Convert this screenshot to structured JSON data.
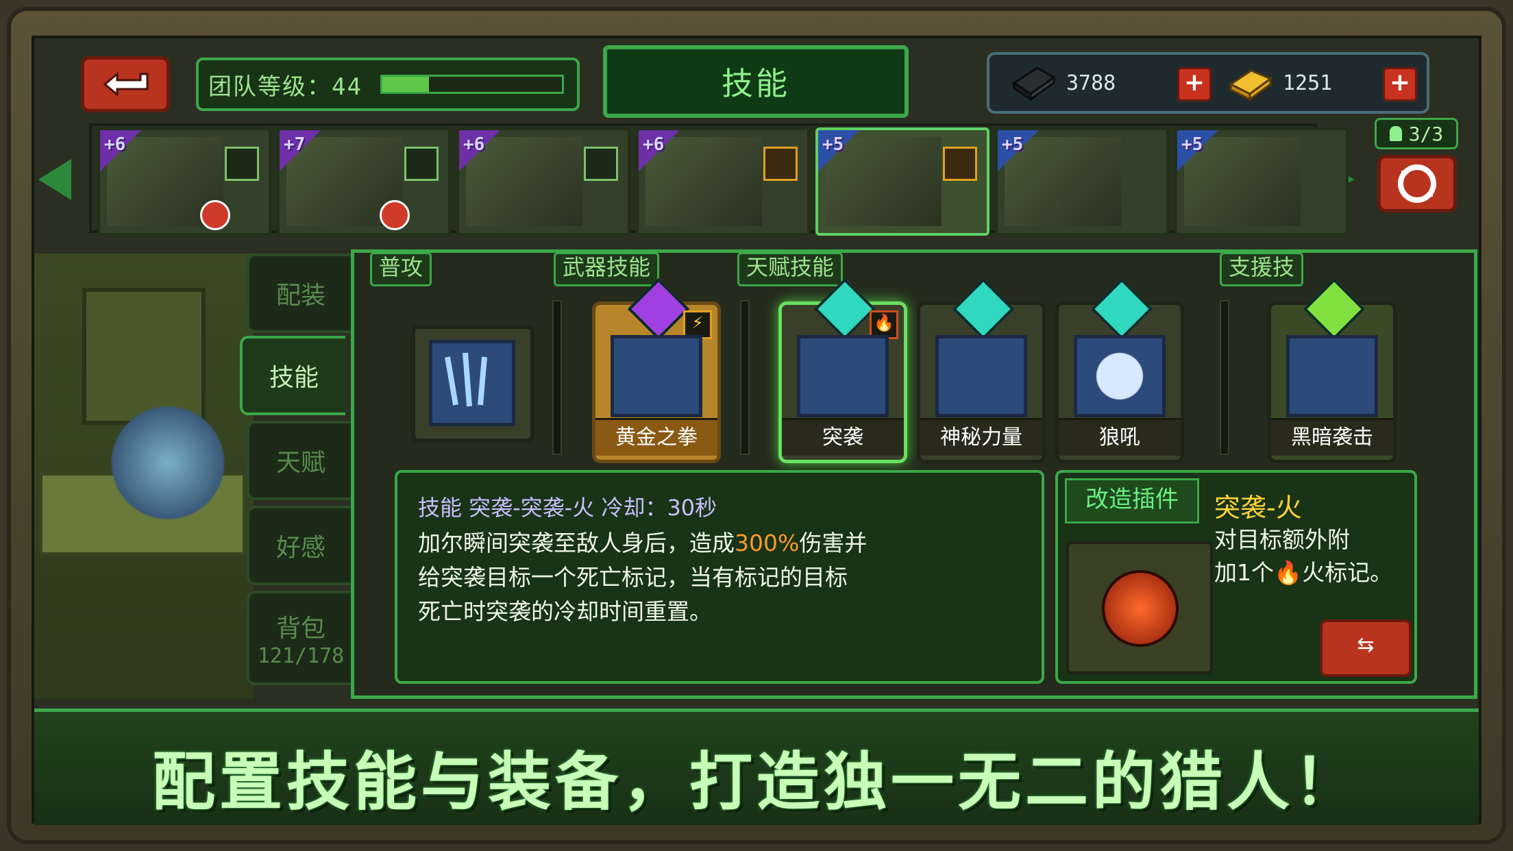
{
  "header": {
    "team_level_label": "团队等级：44",
    "team_level_progress": 0.26,
    "title": "技能",
    "currency_crystal": "3788",
    "currency_gold": "1251",
    "plus": "+"
  },
  "heroes": [
    {
      "badge": "+6",
      "role": "person",
      "tri": "purple",
      "dot": true
    },
    {
      "badge": "+7",
      "role": "person",
      "tri": "purple",
      "dot": true
    },
    {
      "badge": "+6",
      "role": "person",
      "tri": "purple",
      "dot": false
    },
    {
      "badge": "+6",
      "role": "arrow",
      "tri": "purple",
      "dot": false
    },
    {
      "badge": "+5",
      "role": "arrow",
      "tri": "blue",
      "dot": false
    },
    {
      "badge": "+5",
      "role": "",
      "tri": "blue",
      "dot": false
    },
    {
      "badge": "+5",
      "role": "",
      "tri": "blue",
      "dot": false
    }
  ],
  "team_count": "3/3",
  "sidebar": {
    "tabs": [
      {
        "label": "配装"
      },
      {
        "label": "技能"
      },
      {
        "label": "天赋"
      },
      {
        "label": "好感"
      },
      {
        "label": "背包",
        "sub": "121/178"
      }
    ]
  },
  "sections": {
    "basic": "普攻",
    "weapon": "武器技能",
    "talent": "天赋技能",
    "support": "支援技"
  },
  "skills": {
    "weapon_name": "黄金之拳",
    "talent_1": "突袭",
    "talent_2": "神秘力量",
    "talent_3": "狼吼",
    "support_name": "黑暗袭击"
  },
  "description": {
    "head": "技能 突袭-突袭-火 冷却：30秒",
    "line1_pre": "加尔瞬间突袭至敌人身后，造成",
    "line1_hl": "300%",
    "line1_post": "伤害并",
    "line2": "给突袭目标一个死亡标记，当有标记的目标",
    "line3": "死亡时突袭的冷却时间重置。"
  },
  "mod": {
    "label": "改造插件",
    "title": "突袭-火",
    "desc_l1": "对目标额外附",
    "desc_l2": "加1个🔥火标记。",
    "swap_btn": "⇆"
  },
  "banner": {
    "text": "配置技能与装备，打造独一无二的猎人！"
  },
  "colors": {
    "accent_green": "#3ca84a",
    "button_red": "#b8341f",
    "highlight_orange": "#ff9a2a"
  }
}
